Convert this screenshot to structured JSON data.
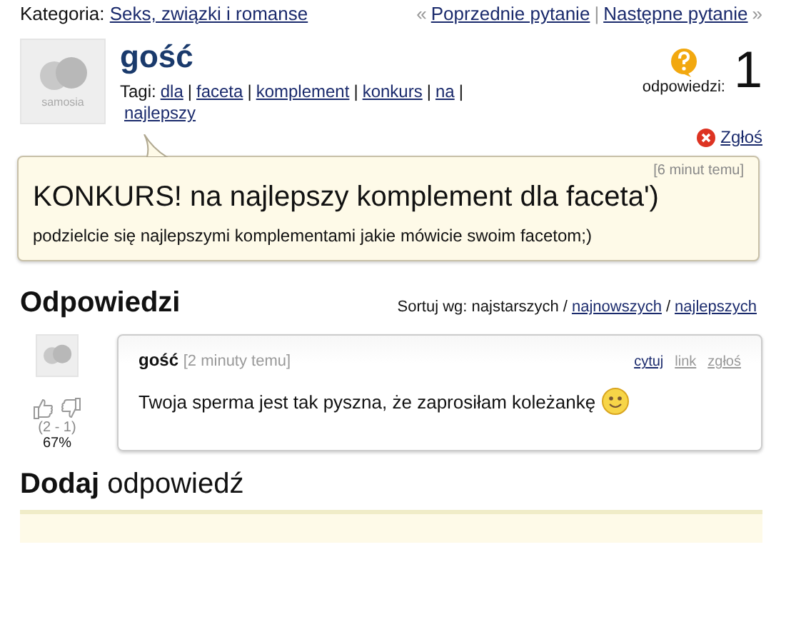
{
  "category": {
    "label": "Kategoria:",
    "link": "Seks, związki i romanse"
  },
  "nav": {
    "prev_mark": "«",
    "prev": "Poprzednie pytanie",
    "separator": "|",
    "next": "Następne pytanie",
    "next_mark": "»"
  },
  "question": {
    "avatar_text": "samosia",
    "author": "gość",
    "tags_label": "Tagi:",
    "tags": [
      "dla",
      "faceta",
      "komplement",
      "konkurs",
      "na",
      "najlepszy"
    ],
    "answers_label": "odpowiedzi:",
    "answers_count": "1",
    "report": "Zgłoś",
    "time": "[6 minut temu]",
    "title": "KONKURS! na najlepszy komplement dla faceta')",
    "body": "podzielcie się najlepszymi komplementami jakie mówicie swoim facetom;)"
  },
  "answers_section": {
    "title": "Odpowiedzi",
    "sort_label": "Sortuj wg:",
    "sort_separator": "/",
    "sort_options": [
      {
        "label": "najstarszych",
        "selected": true
      },
      {
        "label": "najnowszych",
        "selected": false
      },
      {
        "label": "najlepszych",
        "selected": false
      }
    ]
  },
  "answers": [
    {
      "author": "gość",
      "time": "[2 minuty temu]",
      "votes": "(2 - 1)",
      "percent": "67%",
      "actions": [
        {
          "label": "cytuj",
          "disabled": false
        },
        {
          "label": "link",
          "disabled": true
        },
        {
          "label": "zgłoś",
          "disabled": true
        }
      ],
      "text": "Twoja sperma jest tak pyszna, że zaprosiłam koleżankę"
    }
  ],
  "add_answer": {
    "title": "**Dodaj** odpowiedź"
  }
}
